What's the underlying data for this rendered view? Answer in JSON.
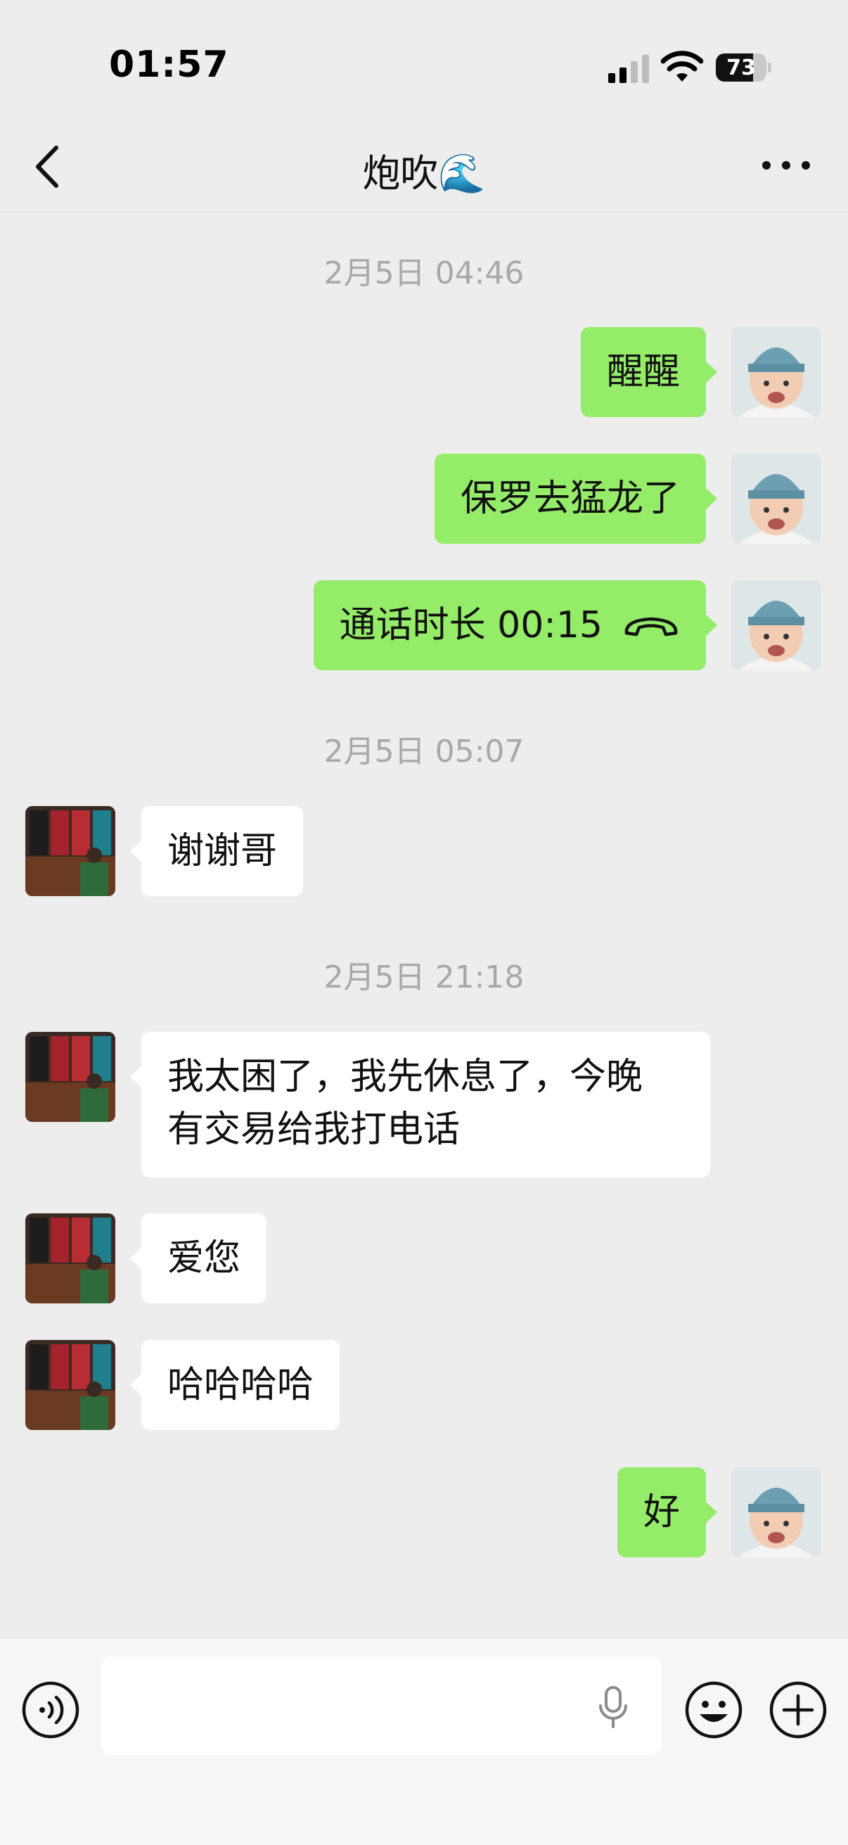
{
  "status": {
    "time": "01:57",
    "battery": "73",
    "battery_level": 0.73
  },
  "header": {
    "title": "炮吹🌊"
  },
  "messages": [
    {
      "type": "timestamp",
      "text": "2月5日 04:46"
    },
    {
      "type": "sent",
      "text": "醒醒"
    },
    {
      "type": "sent",
      "text": "保罗去猛龙了"
    },
    {
      "type": "sent-call",
      "text": "通话时长 00:15"
    },
    {
      "type": "timestamp",
      "text": "2月5日 05:07"
    },
    {
      "type": "received",
      "text": "谢谢哥"
    },
    {
      "type": "timestamp",
      "text": "2月5日 21:18"
    },
    {
      "type": "received",
      "line1": "我太困了，我先休息了，今晚",
      "line2": "有交易给我打电话"
    },
    {
      "type": "received",
      "text": "爱您"
    },
    {
      "type": "received",
      "text": "哈哈哈哈"
    },
    {
      "type": "sent",
      "text": "好"
    }
  ],
  "input": {
    "value": "",
    "placeholder": ""
  },
  "icons": {
    "back": "chevron-left-icon",
    "more": "more-dots-icon",
    "call": "phone-hangup-icon",
    "voice": "voice-input-icon",
    "mic": "microphone-icon",
    "emoji": "emoji-icon",
    "plus": "plus-icon"
  },
  "colors": {
    "sent_bubble": "#95ec69",
    "received_bubble": "#ffffff",
    "background": "#ededed"
  }
}
